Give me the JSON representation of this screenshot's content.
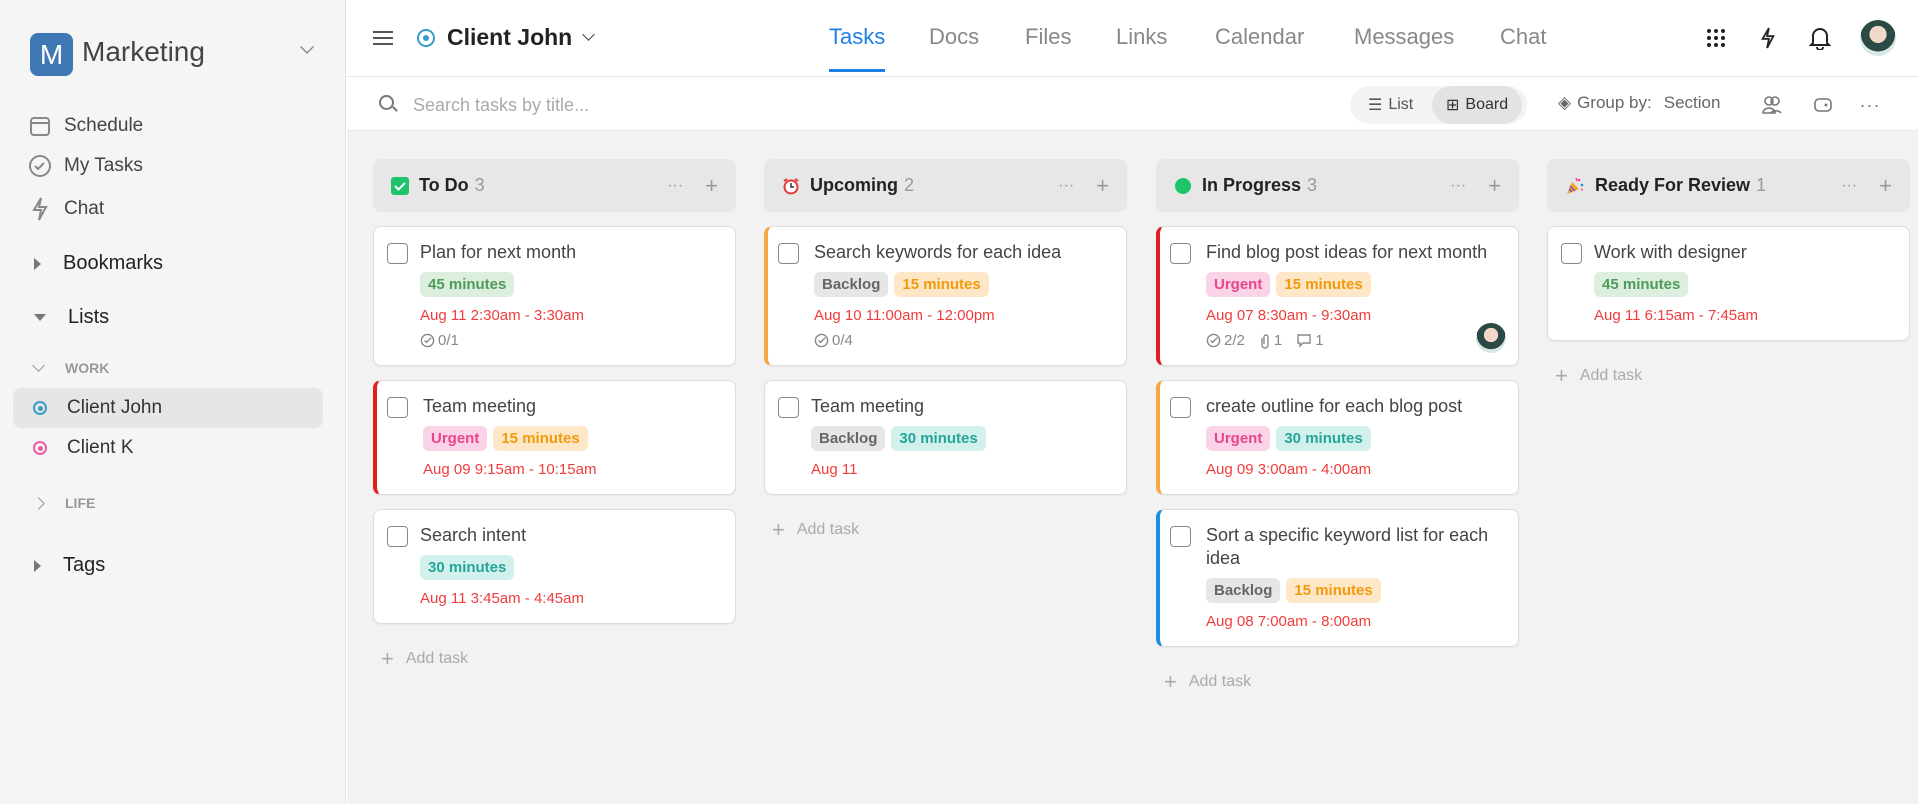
{
  "workspace": {
    "initial": "M",
    "name": "Marketing"
  },
  "sidebar": {
    "nav": [
      {
        "label": "Schedule",
        "icon": "calendar-icon"
      },
      {
        "label": "My Tasks",
        "icon": "check-circle-icon"
      },
      {
        "label": "Chat",
        "icon": "lightning-icon"
      }
    ],
    "bookmarks": "Bookmarks",
    "lists": "Lists",
    "work_group": "WORK",
    "lists_items": [
      {
        "label": "Client John",
        "color": "#3a9cc7",
        "selected": true
      },
      {
        "label": "Client K",
        "color": "#ef5ba1",
        "selected": false
      }
    ],
    "life_group": "LIFE",
    "tags": "Tags"
  },
  "header": {
    "project": "Client John",
    "tabs": [
      "Tasks",
      "Docs",
      "Files",
      "Links",
      "Calendar",
      "Messages",
      "Chat"
    ],
    "active_tab": "Tasks"
  },
  "toolbar": {
    "search_placeholder": "Search tasks by title...",
    "view_list": "List",
    "view_board": "Board",
    "active_view": "Board",
    "group_by_label": "Group by:",
    "group_by_value": "Section"
  },
  "add_task": "Add task",
  "columns": [
    {
      "title": "To Do",
      "count": "3",
      "icon": "checkbox-icon",
      "cards": [
        {
          "title": "Plan for next month",
          "tags": [
            {
              "label": "45 minutes",
              "kind": "green"
            }
          ],
          "date": "Aug 11 2:30am - 3:30am",
          "subtasks": "0/1"
        },
        {
          "title": "Team meeting",
          "border": "#e0201f",
          "tags": [
            {
              "label": "Urgent",
              "kind": "pink"
            },
            {
              "label": "15 minutes",
              "kind": "orange"
            }
          ],
          "date": "Aug 09 9:15am - 10:15am"
        },
        {
          "title": "Search intent",
          "tags": [
            {
              "label": "30 minutes",
              "kind": "teal"
            }
          ],
          "date": "Aug 11 3:45am - 4:45am"
        }
      ]
    },
    {
      "title": "Upcoming",
      "count": "2",
      "icon": "alarm-clock-icon",
      "cards": [
        {
          "title": "Search keywords for each idea",
          "border": "#f5a742",
          "tags": [
            {
              "label": "Backlog",
              "kind": "gray"
            },
            {
              "label": "15 minutes",
              "kind": "orange"
            }
          ],
          "date": "Aug 10 11:00am - 12:00pm",
          "subtasks": "0/4"
        },
        {
          "title": "Team meeting",
          "tags": [
            {
              "label": "Backlog",
              "kind": "gray"
            },
            {
              "label": "30 minutes",
              "kind": "teal"
            }
          ],
          "date": "Aug 11"
        }
      ]
    },
    {
      "title": "In Progress",
      "count": "3",
      "icon": "green-dot-icon",
      "cards": [
        {
          "title": "Find blog post ideas for next month",
          "border": "#e0201f",
          "tags": [
            {
              "label": "Urgent",
              "kind": "pink"
            },
            {
              "label": "15 minutes",
              "kind": "orange"
            }
          ],
          "date": "Aug 07 8:30am - 9:30am",
          "subtasks": "2/2",
          "attachments": "1",
          "comments": "1",
          "avatar": true
        },
        {
          "title": "create outline for each blog post",
          "border": "#f5a742",
          "tags": [
            {
              "label": "Urgent",
              "kind": "pink"
            },
            {
              "label": "30 minutes",
              "kind": "teal"
            }
          ],
          "date": "Aug 09 3:00am - 4:00am"
        },
        {
          "title": "Sort a specific keyword list for each idea",
          "border": "#1a8fe3",
          "tags": [
            {
              "label": "Backlog",
              "kind": "gray"
            },
            {
              "label": "15 minutes",
              "kind": "orange"
            }
          ],
          "date": "Aug 08 7:00am - 8:00am"
        }
      ]
    },
    {
      "title": "Ready For Review",
      "count": "1",
      "icon": "party-popper-icon",
      "cards": [
        {
          "title": "Work with designer",
          "tags": [
            {
              "label": "45 minutes",
              "kind": "green"
            }
          ],
          "date": "Aug 11 6:15am - 7:45am"
        }
      ]
    }
  ],
  "tag_colors": {
    "green": {
      "bg": "#dcefdf",
      "fg": "#4f9a5a"
    },
    "orange": {
      "bg": "#fde7c7",
      "fg": "#f29a0e"
    },
    "teal": {
      "bg": "#d2f0ec",
      "fg": "#26a69a"
    },
    "pink": {
      "bg": "#fbd3e6",
      "fg": "#e8458b"
    },
    "gray": {
      "bg": "#e6e6e6",
      "fg": "#666666"
    }
  }
}
